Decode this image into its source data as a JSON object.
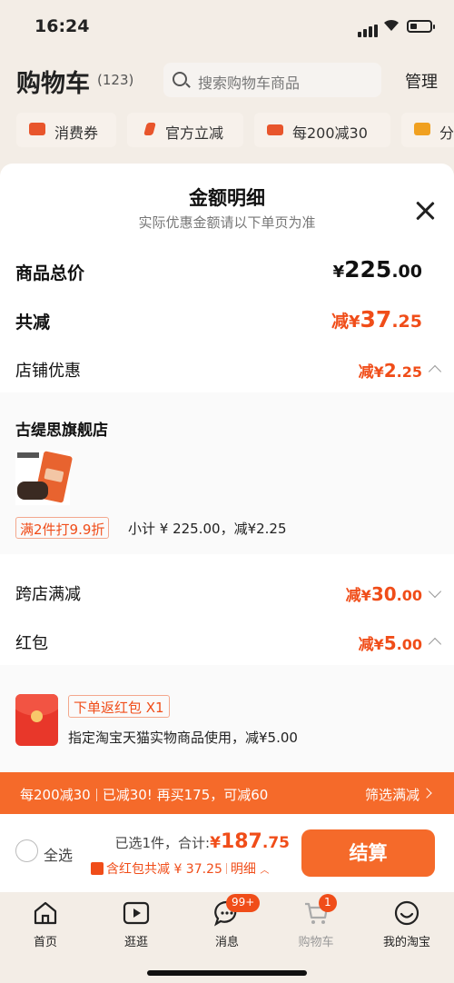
{
  "status_bar": {
    "time": "16:24"
  },
  "header": {
    "title": "购物车",
    "count": "(123)",
    "search_placeholder": "搜索购物车商品",
    "manage": "管理"
  },
  "filter_chips": [
    {
      "label": "消费券",
      "icon": "coupon-icon"
    },
    {
      "label": "官方立减",
      "icon": "lightning-icon"
    },
    {
      "label": "每200减30",
      "icon": "store-icon"
    },
    {
      "label": "分",
      "icon": "folder-icon"
    }
  ],
  "sheet": {
    "title": "金额明细",
    "subtitle": "实际优惠金额请以下单页为准",
    "total_price": {
      "label": "商品总价",
      "currency": "¥",
      "int": "225",
      "dec": ".00"
    },
    "total_discount": {
      "label": "共减",
      "prefix": "减",
      "currency": "¥",
      "int": "37",
      "dec": ".25"
    },
    "store_discount": {
      "label": "店铺优惠",
      "prefix": "减",
      "currency": "¥",
      "int": "2",
      "dec": ".25"
    },
    "shop": {
      "name": "古缇思旗舰店",
      "promo_tag": "满2件打9.9折",
      "subtotal": "小计 ¥ 225.00，减¥2.25"
    },
    "cross_store": {
      "label": "跨店满减",
      "prefix": "减",
      "currency": "¥",
      "int": "30",
      "dec": ".00"
    },
    "red_packet": {
      "label": "红包",
      "prefix": "减",
      "currency": "¥",
      "int": "5",
      "dec": ".00"
    },
    "red_packet_detail": {
      "tag": "下单返红包 X1",
      "desc": "指定淘宝天猫实物商品使用，减¥5.00"
    }
  },
  "promo_bar": {
    "part1": "每200减30",
    "part2": "已减30!",
    "part3": "再买175，可减60",
    "link": "筛选满减"
  },
  "checkout": {
    "select_all": "全选",
    "selected": "已选1件，合计:",
    "currency": "¥",
    "total_int": "187",
    "total_dec": ".75",
    "red_packet_note": "含红包共减 ¥ 37.25",
    "detail_link": "明细",
    "pay": "结算"
  },
  "tabbar": [
    {
      "label": "首页",
      "icon": "home-icon"
    },
    {
      "label": "逛逛",
      "icon": "play-icon"
    },
    {
      "label": "消息",
      "icon": "message-icon",
      "badge": "99+"
    },
    {
      "label": "购物车",
      "icon": "cart-icon",
      "badge": "1"
    },
    {
      "label": "我的淘宝",
      "icon": "smile-icon"
    }
  ],
  "colors": {
    "accent": "#f04d19",
    "button": "#f56a2a",
    "dim_bg": "#f3ede6"
  }
}
